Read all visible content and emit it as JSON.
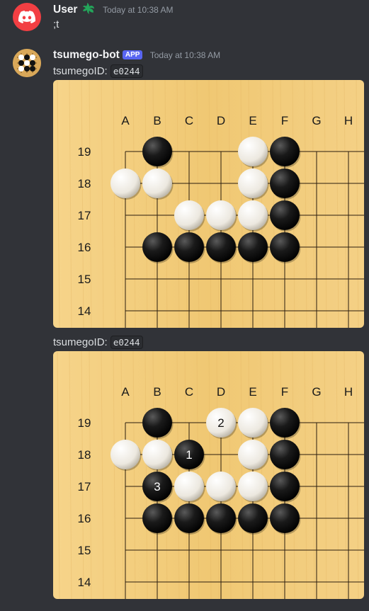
{
  "user_message": {
    "avatar_icon": "discord-logo-icon",
    "author": "User",
    "badge_icon": "leaf-icon",
    "timestamp": "Today at 10:38 AM",
    "text": ";t"
  },
  "bot_message": {
    "avatar_icon": "go-stones-icon",
    "author": "tsumego-bot",
    "app_badge": "APP",
    "timestamp": "Today at 10:38 AM",
    "label": "tsumegoID:",
    "tsumego_id": "e0244",
    "label2": "tsumegoID:",
    "tsumego_id2": "e0244"
  },
  "boards": [
    {
      "columns": [
        "A",
        "B",
        "C",
        "D",
        "E",
        "F",
        "G",
        "H"
      ],
      "rows": [
        "19",
        "18",
        "17",
        "16",
        "15",
        "14"
      ],
      "black": [
        [
          "B",
          19
        ],
        [
          "F",
          19
        ],
        [
          "F",
          18
        ],
        [
          "F",
          17
        ],
        [
          "B",
          16
        ],
        [
          "C",
          16
        ],
        [
          "D",
          16
        ],
        [
          "E",
          16
        ],
        [
          "F",
          16
        ]
      ],
      "white": [
        [
          "E",
          19
        ],
        [
          "A",
          18
        ],
        [
          "B",
          18
        ],
        [
          "E",
          18
        ],
        [
          "C",
          17
        ],
        [
          "D",
          17
        ],
        [
          "E",
          17
        ]
      ],
      "numbered": []
    },
    {
      "columns": [
        "A",
        "B",
        "C",
        "D",
        "E",
        "F",
        "G",
        "H"
      ],
      "rows": [
        "19",
        "18",
        "17",
        "16",
        "15",
        "14"
      ],
      "black": [
        [
          "B",
          19
        ],
        [
          "F",
          19
        ],
        [
          "F",
          18
        ],
        [
          "F",
          17
        ],
        [
          "B",
          16
        ],
        [
          "C",
          16
        ],
        [
          "D",
          16
        ],
        [
          "E",
          16
        ],
        [
          "F",
          16
        ]
      ],
      "white": [
        [
          "E",
          19
        ],
        [
          "A",
          18
        ],
        [
          "B",
          18
        ],
        [
          "E",
          18
        ],
        [
          "C",
          17
        ],
        [
          "D",
          17
        ],
        [
          "E",
          17
        ]
      ],
      "numbered": [
        {
          "pos": [
            "C",
            18
          ],
          "color": "black",
          "label": "1"
        },
        {
          "pos": [
            "D",
            19
          ],
          "color": "white",
          "label": "2"
        },
        {
          "pos": [
            "B",
            17
          ],
          "color": "black",
          "label": "3"
        }
      ]
    }
  ],
  "colors": {
    "background": "#313338",
    "wood": "#f0c873",
    "app_badge": "#5865f2",
    "discord_red": "#f23f43"
  }
}
